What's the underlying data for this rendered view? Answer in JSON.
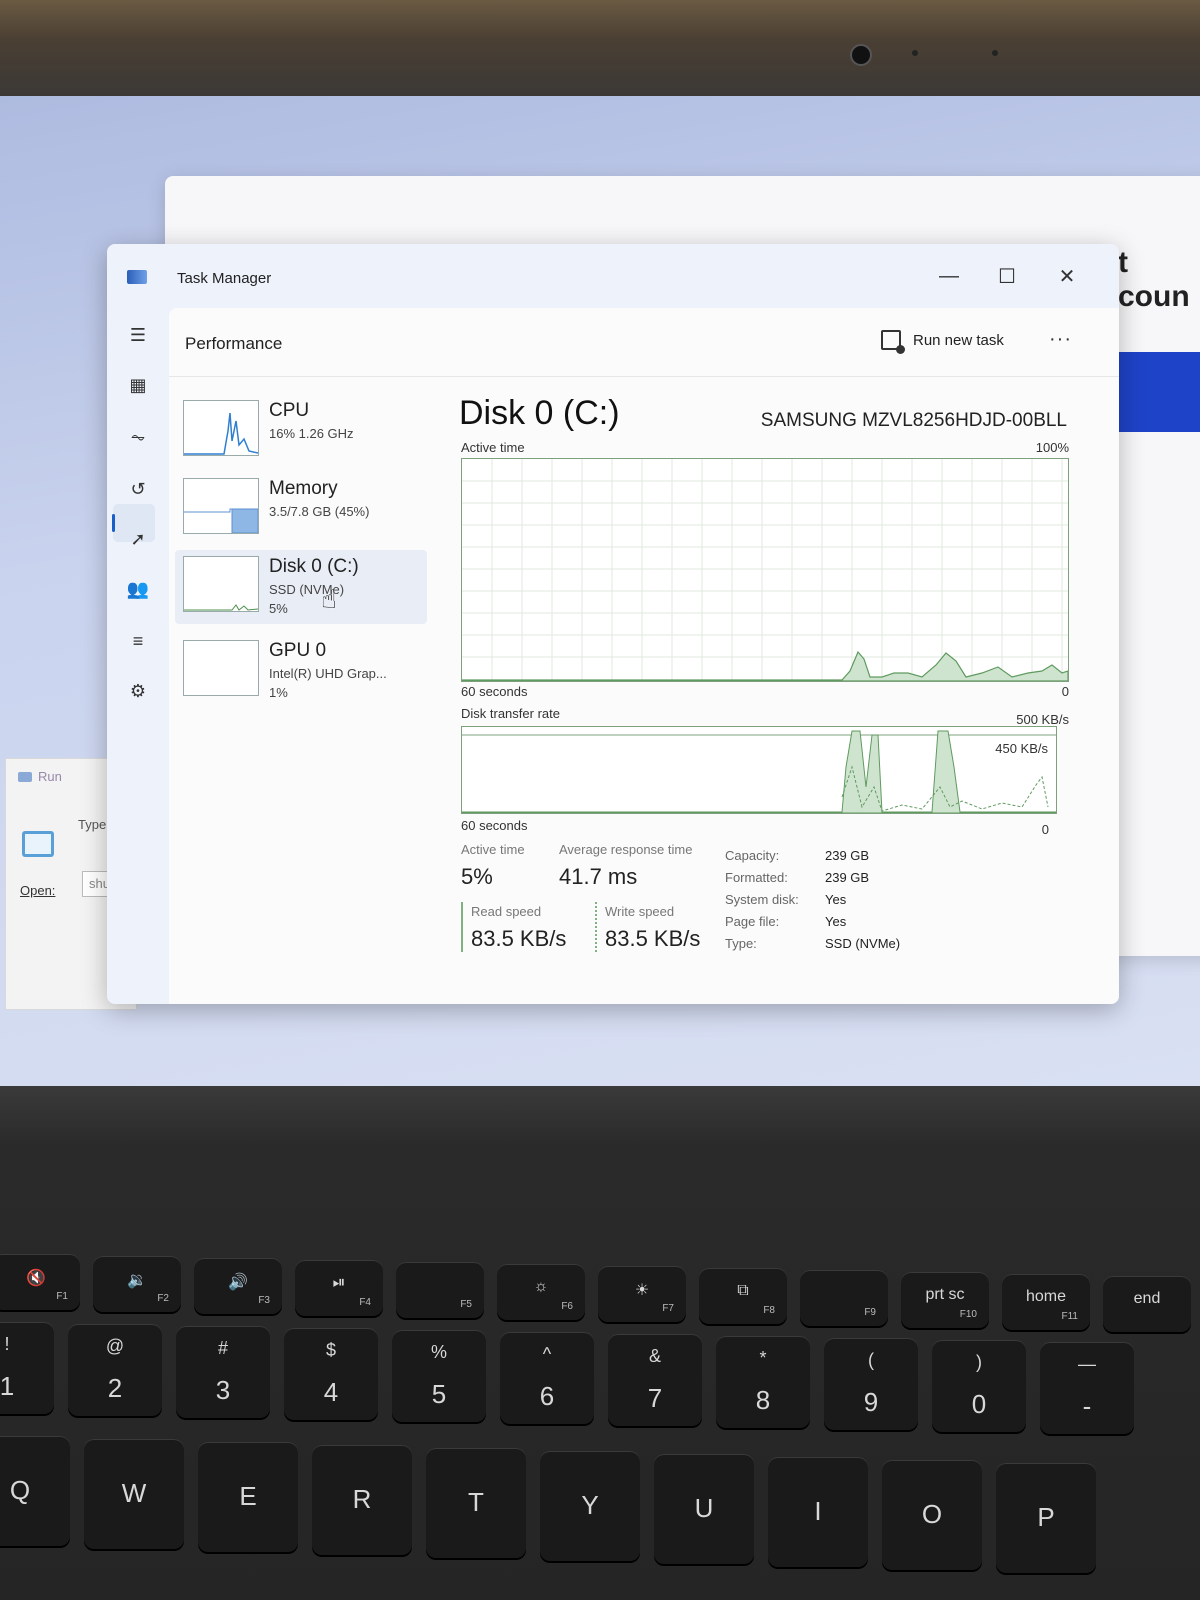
{
  "back_window": {
    "title_fragment": "t coun"
  },
  "run_dialog": {
    "title": "Run",
    "description": "Type t resour",
    "open_label": "Open:",
    "open_value": "shutc"
  },
  "window": {
    "title": "Task Manager",
    "controls": {
      "minimize": "—",
      "maximize": "☐",
      "close": "✕"
    }
  },
  "nav": {
    "items": [
      {
        "icon": "hamburger-icon",
        "glyph": "☰"
      },
      {
        "icon": "processes-icon",
        "glyph": "▦"
      },
      {
        "icon": "performance-icon",
        "glyph": "⏦",
        "active": true
      },
      {
        "icon": "app-history-icon",
        "glyph": "↺"
      },
      {
        "icon": "startup-apps-icon",
        "glyph": "➚"
      },
      {
        "icon": "users-icon",
        "glyph": "👥"
      },
      {
        "icon": "details-icon",
        "glyph": "≡"
      },
      {
        "icon": "services-icon",
        "glyph": "⚙"
      }
    ],
    "settings_glyph": "⚙"
  },
  "header": {
    "title": "Performance",
    "run_new_task": "Run new task",
    "more": "···"
  },
  "resources": [
    {
      "name": "CPU",
      "line1": "16%  1.26 GHz",
      "line2": ""
    },
    {
      "name": "Memory",
      "line1": "3.5/7.8 GB (45%)",
      "line2": ""
    },
    {
      "name": "Disk 0 (C:)",
      "line1": "SSD (NVMe)",
      "line2": "5%",
      "selected": true
    },
    {
      "name": "GPU 0",
      "line1": "Intel(R) UHD Grap...",
      "line2": "1%"
    }
  ],
  "detail": {
    "title": "Disk 0 (C:)",
    "model": "SAMSUNG MZVL8256HDJD-00BLL",
    "active_chart": {
      "label": "Active time",
      "max_label": "100%",
      "time_label": "60 seconds",
      "min_label": "0"
    },
    "transfer_chart": {
      "label": "Disk transfer rate",
      "max_label": "500 KB/s",
      "secondary_label": "450 KB/s",
      "time_label": "60 seconds",
      "min_label": "0"
    },
    "stats": {
      "active_time_label": "Active time",
      "active_time_value": "5%",
      "avg_response_label": "Average response time",
      "avg_response_value": "41.7 ms",
      "read_speed_label": "Read speed",
      "read_speed_value": "83.5 KB/s",
      "write_speed_label": "Write speed",
      "write_speed_value": "83.5 KB/s"
    },
    "properties": [
      {
        "label": "Capacity:",
        "value": "239 GB"
      },
      {
        "label": "Formatted:",
        "value": "239 GB"
      },
      {
        "label": "System disk:",
        "value": "Yes"
      },
      {
        "label": "Page file:",
        "value": "Yes"
      },
      {
        "label": "Type:",
        "value": "SSD (NVMe)"
      }
    ]
  },
  "keyboard": {
    "fn_row": [
      {
        "glyph": "🔇",
        "fn": "F1"
      },
      {
        "glyph": "🔉",
        "fn": "F2"
      },
      {
        "glyph": "🔊",
        "fn": "F3"
      },
      {
        "glyph": "⏯",
        "fn": "F4"
      },
      {
        "glyph": "",
        "fn": "F5"
      },
      {
        "glyph": "☼",
        "fn": "F6"
      },
      {
        "glyph": "☀",
        "fn": "F7"
      },
      {
        "glyph": "⧉",
        "fn": "F8"
      },
      {
        "glyph": "",
        "fn": "F9"
      },
      {
        "glyph": "prt sc",
        "fn": "F10"
      },
      {
        "glyph": "home",
        "fn": "F11"
      },
      {
        "glyph": "end",
        "fn": ""
      }
    ],
    "num_row": [
      {
        "top": "!",
        "main": "1"
      },
      {
        "top": "@",
        "main": "2"
      },
      {
        "top": "#",
        "main": "3"
      },
      {
        "top": "$",
        "main": "4"
      },
      {
        "top": "%",
        "main": "5"
      },
      {
        "top": "^",
        "main": "6"
      },
      {
        "top": "&",
        "main": "7"
      },
      {
        "top": "*",
        "main": "8"
      },
      {
        "top": "(",
        "main": "9"
      },
      {
        "top": ")",
        "main": "0"
      },
      {
        "top": "—",
        "main": "-"
      }
    ],
    "letter_row": [
      "Q",
      "W",
      "E",
      "R",
      "T",
      "Y",
      "U",
      "I",
      "O",
      "P"
    ]
  }
}
